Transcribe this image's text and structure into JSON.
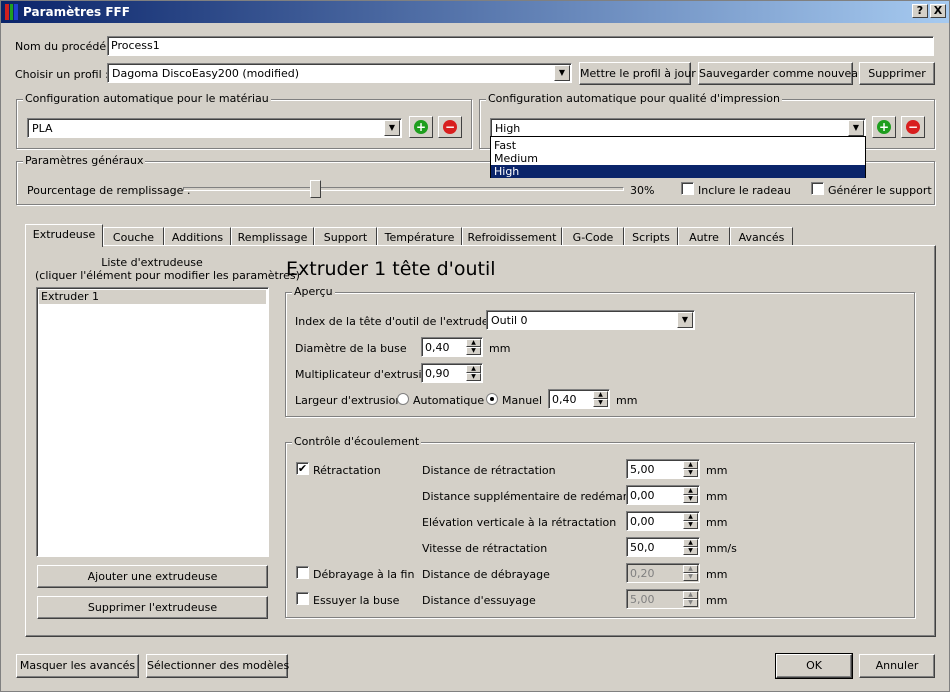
{
  "window": {
    "title": "Paramètres FFF"
  },
  "titlebar_buttons": {
    "help": "?",
    "close": "X"
  },
  "process": {
    "label": "Nom du procédé :",
    "value": "Process1"
  },
  "profile": {
    "label": "Choisir un profil :",
    "value": "Dagoma DiscoEasy200 (modified)",
    "update_btn": "Mettre le profil à jour",
    "save_new_btn": "Sauvegarder comme nouveau",
    "delete_btn": "Supprimer"
  },
  "material": {
    "group": "Configuration automatique pour le matériau",
    "value": "PLA"
  },
  "quality": {
    "group": "Configuration automatique pour qualité d'impression",
    "value": "High",
    "options": [
      "Fast",
      "Medium",
      "High"
    ]
  },
  "general": {
    "group": "Paramètres généraux",
    "infill_label": "Pourcentage de remplissage :",
    "infill_value": "30%",
    "infill_fraction": 0.3,
    "raft_label": "Inclure le radeau",
    "support_label": "Générer le support"
  },
  "tabs": [
    "Extrudeuse",
    "Couche",
    "Additions",
    "Remplissage",
    "Support",
    "Température",
    "Refroidissement",
    "G-Code",
    "Scripts",
    "Autre",
    "Avancés"
  ],
  "extruder_list": {
    "title_line1": "Liste d'extrudeuse",
    "title_line2": "(cliquer l'élément pour modifier les paramètres)",
    "items": [
      "Extruder 1"
    ],
    "add_btn": "Ajouter une extrudeuse",
    "remove_btn": "Supprimer l'extrudeuse"
  },
  "extruder": {
    "heading": "Extruder 1 tête d'outil",
    "overview": {
      "group": "Aperçu",
      "tool_index_label": "Index de la tête d'outil de l'extrudeuse",
      "tool_index_value": "Outil 0",
      "nozzle_label": "Diamètre de la buse",
      "nozzle_value": "0,40",
      "nozzle_unit": "mm",
      "mult_label": "Multiplicateur d'extrusion",
      "mult_value": "0,90",
      "width_label": "Largeur d'extrusion",
      "auto_label": "Automatique",
      "manual_label": "Manuel",
      "width_value": "0,40",
      "width_unit": "mm"
    },
    "flow": {
      "group": "Contrôle d'écoulement",
      "retraction_label": "Rétractation",
      "retract_dist_label": "Distance de rétractation",
      "retract_dist_value": "5,00",
      "extra_restart_label": "Distance supplémentaire de redémarrage",
      "extra_restart_value": "0,00",
      "lift_label": "Elévation verticale à la rétractation",
      "lift_value": "0,00",
      "speed_label": "Vitesse de rétractation",
      "speed_value": "50,0",
      "speed_unit": "mm/s",
      "coast_check_label": "Débrayage à la fin",
      "coast_label": "Distance de débrayage",
      "coast_value": "0,20",
      "wipe_check_label": "Essuyer la buse",
      "wipe_label": "Distance d'essuyage",
      "wipe_value": "5,00",
      "unit": "mm"
    }
  },
  "footer": {
    "hide_advanced": "Masquer les avancés",
    "select_models": "Sélectionner des modèles",
    "ok": "OK",
    "cancel": "Annuler"
  }
}
